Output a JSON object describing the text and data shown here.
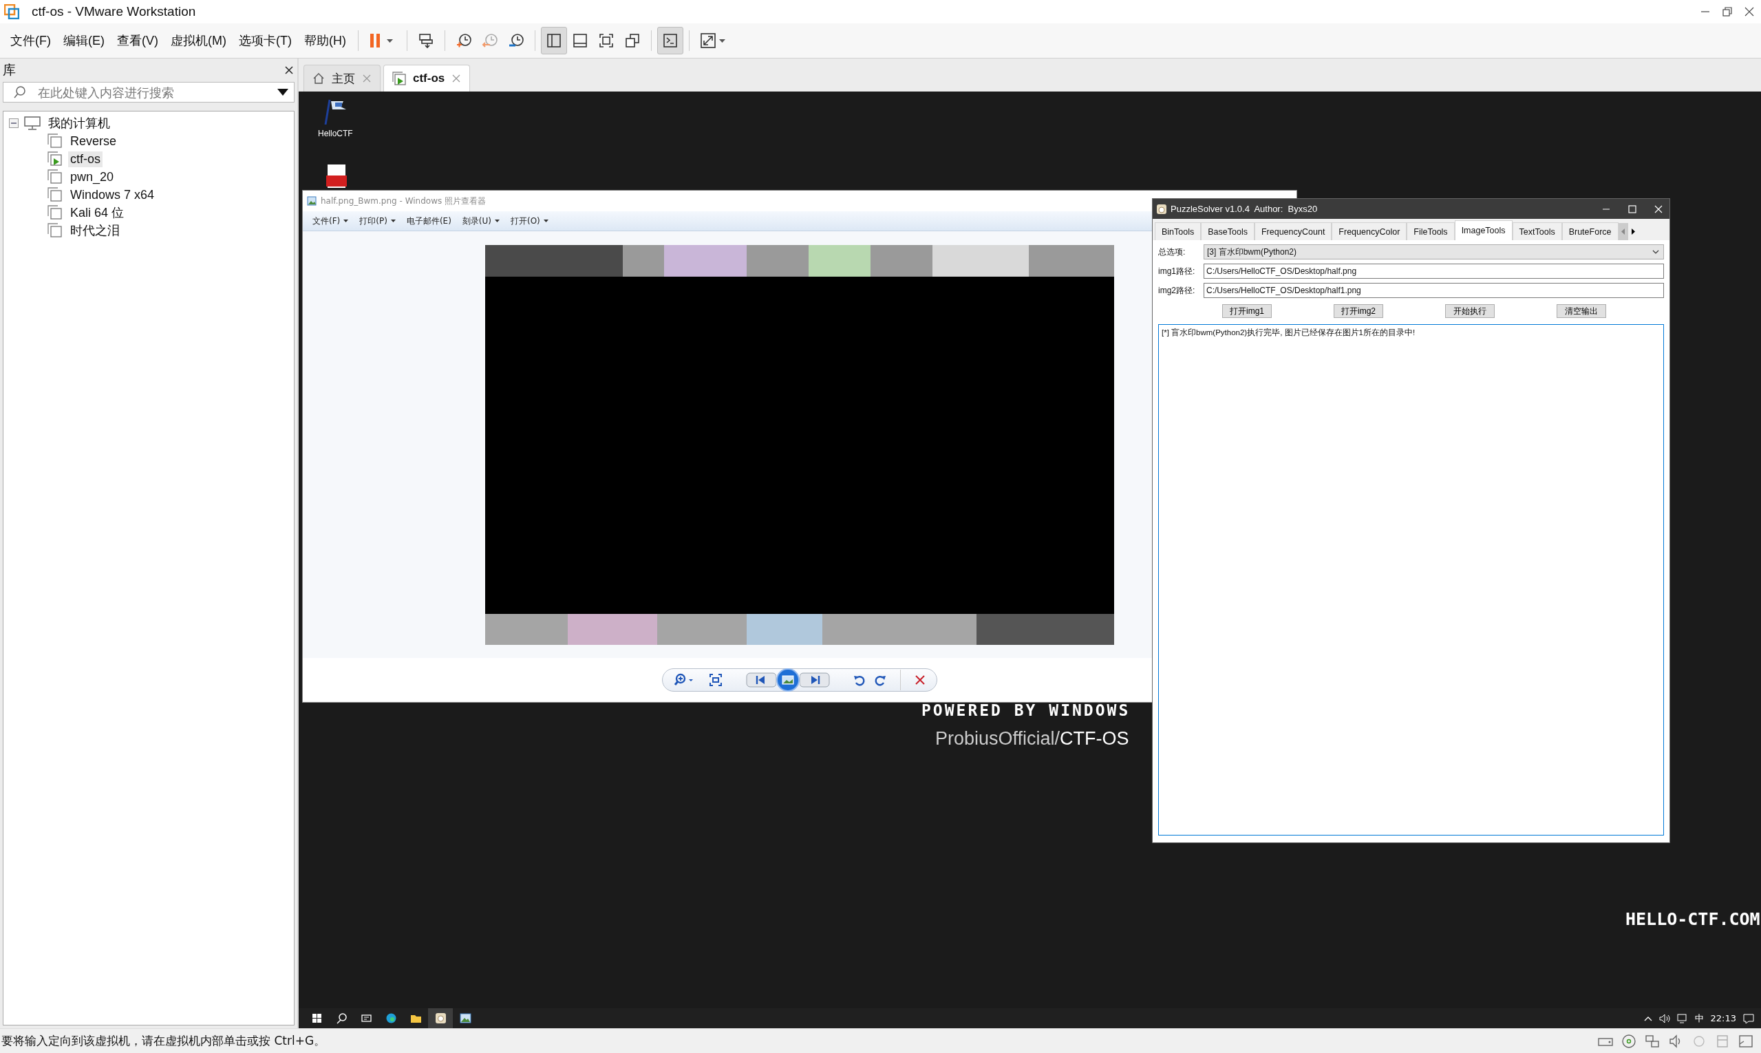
{
  "window": {
    "title": "ctf-os - VMware Workstation"
  },
  "menu": [
    "文件(F)",
    "编辑(E)",
    "查看(V)",
    "虚拟机(M)",
    "选项卡(T)",
    "帮助(H)"
  ],
  "toolbar": [
    {
      "kind": "pause",
      "pressed": false
    },
    {
      "kind": "send-keys",
      "pressed": false
    },
    {
      "kind": "snapshot-take",
      "pressed": false
    },
    {
      "kind": "snapshot-revert",
      "pressed": false
    },
    {
      "kind": "snapshot-manage",
      "pressed": false
    },
    {
      "kind": "view-library",
      "pressed": true
    },
    {
      "kind": "view-thumbs",
      "pressed": false
    },
    {
      "kind": "view-full",
      "pressed": false
    },
    {
      "kind": "view-unity",
      "pressed": false
    },
    {
      "kind": "console",
      "pressed": true
    },
    {
      "kind": "stretch",
      "pressed": false
    }
  ],
  "library": {
    "title": "库",
    "search": {
      "placeholder": "在此处键入内容进行搜索"
    },
    "tree": [
      {
        "label": "我的计算机",
        "expanded": true,
        "children": [
          {
            "label": "Reverse",
            "running": false,
            "selected": false
          },
          {
            "label": "ctf-os",
            "running": true,
            "selected": true
          },
          {
            "label": "pwn_20",
            "running": false,
            "selected": false
          },
          {
            "label": "Windows 7 x64",
            "running": false,
            "selected": false
          },
          {
            "label": "Kali 64 位",
            "running": false,
            "selected": false
          },
          {
            "label": "时代之泪",
            "running": false,
            "selected": false
          }
        ]
      }
    ]
  },
  "tabs": [
    {
      "label": "主页",
      "kind": "home",
      "selected": false
    },
    {
      "label": "ctf-os",
      "kind": "vm",
      "selected": true
    }
  ],
  "desktop": {
    "icons": [
      {
        "label": "HelloCTF",
        "kind": "flag"
      },
      {
        "kind": "pdf"
      }
    ],
    "powered_by": "POWERED BY WINDOWS",
    "credit_user": "ProbiusOfficial/",
    "credit_repo": "CTF-OS",
    "site": "HELLO-CTF.COM"
  },
  "photo_viewer": {
    "title": "half.png_Bwm.png - Windows 照片查看器",
    "menu": [
      {
        "label": "文件(F)",
        "dropdown": true
      },
      {
        "label": "打印(P)",
        "dropdown": true
      },
      {
        "label": "电子邮件(E)",
        "dropdown": false
      },
      {
        "label": "刻录(U)",
        "dropdown": true
      },
      {
        "label": "打开(O)",
        "dropdown": true
      }
    ]
  },
  "puzzle_solver": {
    "title": "PuzzleSolver v1.0.4  Author:  Byxs20",
    "tabs": [
      {
        "label": "BinTools",
        "selected": false
      },
      {
        "label": "BaseTools",
        "selected": false
      },
      {
        "label": "FrequencyCount",
        "selected": false
      },
      {
        "label": "FrequencyColor",
        "selected": false
      },
      {
        "label": "FileTools",
        "selected": false
      },
      {
        "label": "ImageTools",
        "selected": true
      },
      {
        "label": "TextTools",
        "selected": false
      },
      {
        "label": "BruteForce",
        "selected": false
      }
    ],
    "option_label": "总选项:",
    "option_value": "[3] 盲水印bwm(Python2)",
    "paths": [
      {
        "label": "img1路径:",
        "value": "C:/Users/HelloCTF_OS/Desktop/half.png"
      },
      {
        "label": "img2路径:",
        "value": "C:/Users/HelloCTF_OS/Desktop/half1.png"
      }
    ],
    "buttons": [
      "打开img1",
      "打开img2",
      "开始执行",
      "清空输出"
    ],
    "output": "[*] 盲水印bwm(Python2)执行完毕, 图片已经保存在图片1所在的目录中!"
  },
  "taskbar": {
    "apps": [
      {
        "kind": "start",
        "active": false
      },
      {
        "kind": "search",
        "active": false
      },
      {
        "kind": "taskview",
        "active": false
      },
      {
        "kind": "edge",
        "active": false
      },
      {
        "kind": "explorer",
        "active": false
      },
      {
        "kind": "puzzle",
        "active": true
      },
      {
        "kind": "viewer",
        "active": false
      }
    ],
    "ime": "中",
    "clock": "22:13"
  },
  "status_bar": "要将输入定向到该虚拟机，请在虚拟机内部单击或按 Ctrl+G。"
}
